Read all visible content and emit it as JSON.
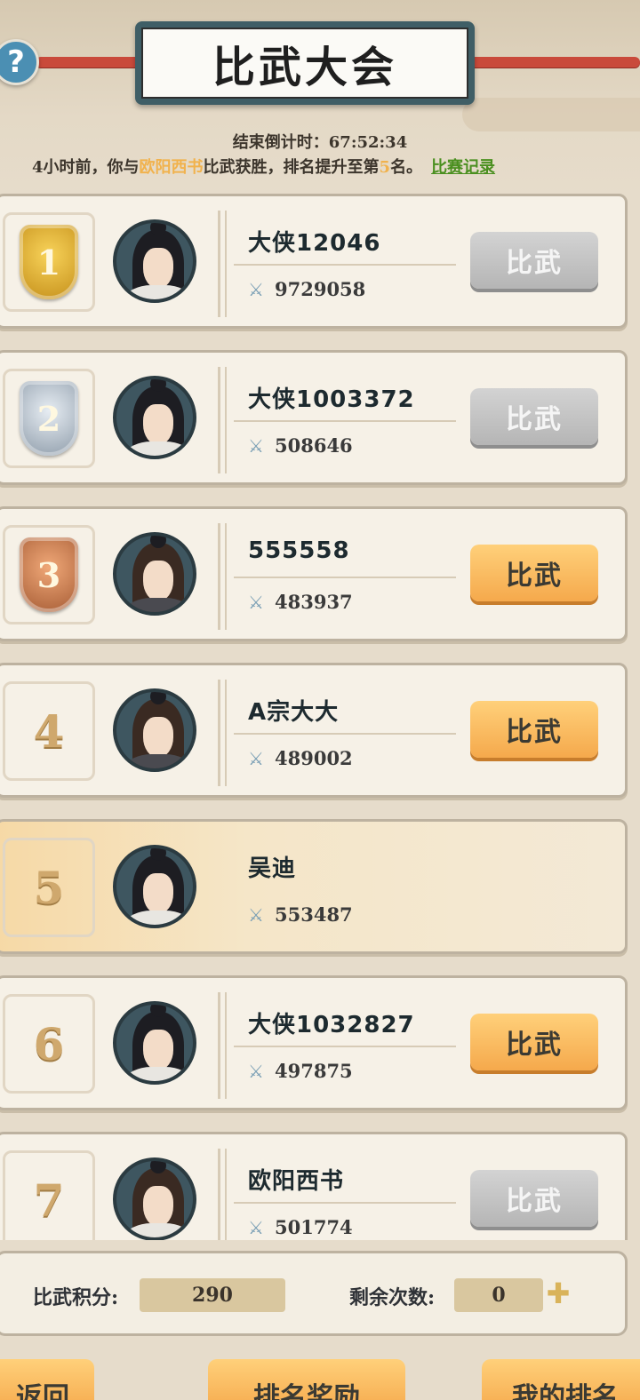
{
  "header": {
    "title": "比武大会",
    "countdown_label": "结束倒计时：",
    "countdown_value": "67:52:34",
    "msg_prefix": "4小时前，你与",
    "msg_opponent": "欧阳西书",
    "msg_mid": "比武获胜，排名提升至第",
    "msg_rank": "5",
    "msg_suffix": "名。",
    "record_link": "比赛记录",
    "help_icon": "?"
  },
  "rows": [
    {
      "rank": "1",
      "name": "大侠12046",
      "power": "9729058",
      "button": "比武",
      "button_state": "disabled"
    },
    {
      "rank": "2",
      "name": "大侠1003372",
      "power": "508646",
      "button": "比武",
      "button_state": "disabled"
    },
    {
      "rank": "3",
      "name": "555558",
      "power": "483937",
      "button": "比武",
      "button_state": "active"
    },
    {
      "rank": "4",
      "name": "A宗大大",
      "power": "489002",
      "button": "比武",
      "button_state": "active"
    },
    {
      "rank": "5",
      "name": "吴迪",
      "power": "553487",
      "button": "",
      "button_state": "self"
    },
    {
      "rank": "6",
      "name": "大侠1032827",
      "power": "497875",
      "button": "比武",
      "button_state": "active"
    },
    {
      "rank": "7",
      "name": "欧阳西书",
      "power": "501774",
      "button": "比武",
      "button_state": "disabled"
    }
  ],
  "footer": {
    "score_label": "比武积分:",
    "score_value": "290",
    "remaining_label": "剩余次数:",
    "remaining_value": "0",
    "back_button": "返回",
    "reward_button": "排名奖励",
    "my_rank_button": "我的排名"
  },
  "colors": {
    "active_button": "#f5a94c",
    "disabled_button": "#b5b5b5",
    "highlight_name": "#f1b24d",
    "record_link": "#4a8f1f"
  }
}
